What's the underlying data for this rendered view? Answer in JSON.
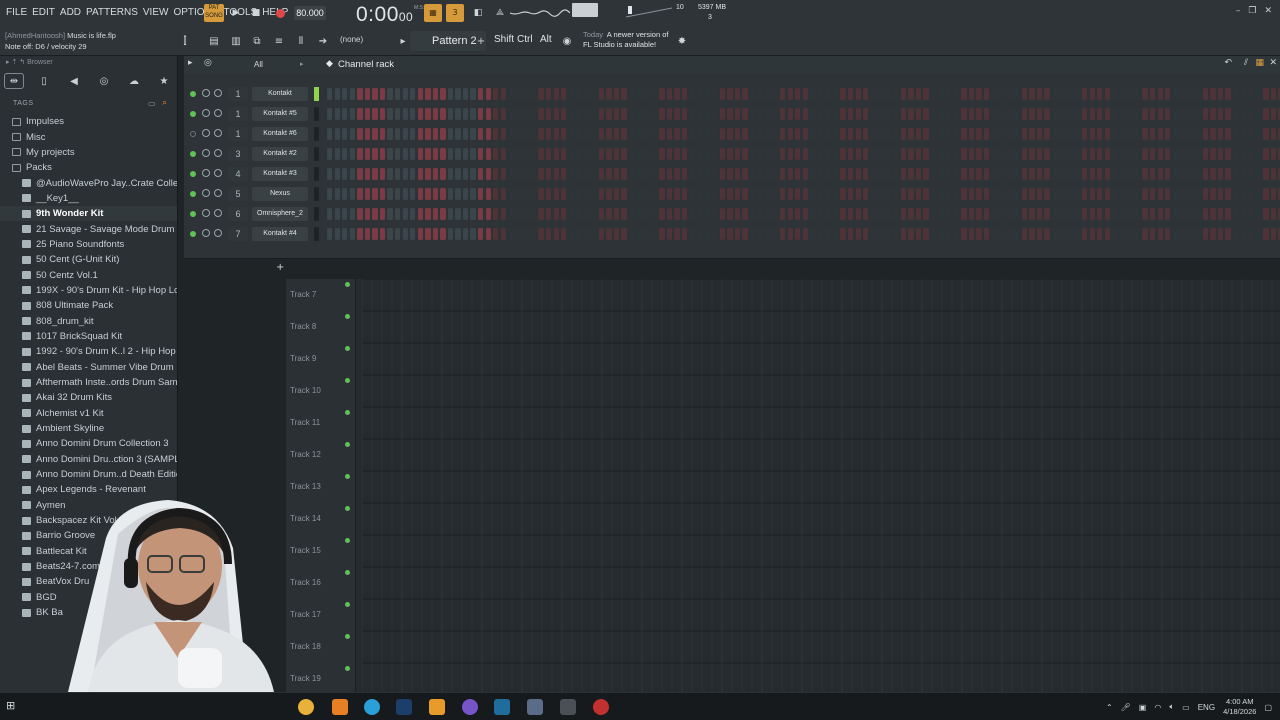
{
  "menu": [
    "FILE",
    "EDIT",
    "ADD",
    "PATTERNS",
    "VIEW",
    "OPTIONS",
    "TOOLS",
    "HELP"
  ],
  "hint": {
    "project_user": "[AhmedHantoosh]",
    "project_file": "Music is life.flp",
    "status": "Note off: D6 / velocity 29"
  },
  "transport": {
    "pat_song": "PAT\nSONG",
    "play": "▶",
    "stop": "■",
    "tempo": "80.000",
    "time_main": "0:00",
    "time_ms": "00",
    "time_unit": "M:S:CS"
  },
  "stats": {
    "cpu": "10",
    "memory": "5397 MB",
    "polyphony": "3"
  },
  "toolbar2": {
    "none_label": "(none)",
    "pattern": "Pattern 2",
    "shift": "Shift",
    "ctrl": "Ctrl",
    "alt": "Alt",
    "news_label": "Today",
    "news_line1": "A newer version of",
    "news_line2": "FL Studio is available!"
  },
  "browser": {
    "title": "Browser",
    "tags_label": "TAGS",
    "items": [
      {
        "label": "Impulses",
        "level": 0
      },
      {
        "label": "Misc",
        "level": 0
      },
      {
        "label": "My projects",
        "level": 0
      },
      {
        "label": "Packs",
        "level": 0
      },
      {
        "label": "@AudioWavePro Jay..Crate Collection",
        "level": 1
      },
      {
        "label": "__Key1__",
        "level": 1
      },
      {
        "label": "9th Wonder Kit",
        "level": 1,
        "selected": true
      },
      {
        "label": "21 Savage - Savage Mode Drum Kit",
        "level": 1
      },
      {
        "label": "25 Piano Soundfonts",
        "level": 1
      },
      {
        "label": "50 Cent (G-Unit Kit)",
        "level": 1
      },
      {
        "label": "50 Centz Vol.1",
        "level": 1
      },
      {
        "label": "199X - 90's Drum Kit - Hip Hop Lofi",
        "level": 1
      },
      {
        "label": "808 Ultimate Pack",
        "level": 1
      },
      {
        "label": "808_drum_kit",
        "level": 1
      },
      {
        "label": "1017 BrickSquad Kit",
        "level": 1
      },
      {
        "label": "1992 - 90's Drum K..l 2 - Hip Hop Lofi",
        "level": 1
      },
      {
        "label": "Abel Beats - Summer Vibe Drum Kit",
        "level": 1
      },
      {
        "label": "Afthermath Inste..ords Drum Samples",
        "level": 1
      },
      {
        "label": "Akai 32 Drum Kits",
        "level": 1
      },
      {
        "label": "Alchemist v1 Kit",
        "level": 1
      },
      {
        "label": "Ambient Skyline",
        "level": 1
      },
      {
        "label": "Anno Domini Drum Collection 3",
        "level": 1
      },
      {
        "label": "Anno Domini Dru..ction 3 (SAMPLER)",
        "level": 1
      },
      {
        "label": "Anno Domini Drum..d Death Edition 3",
        "level": 1
      },
      {
        "label": "Apex Legends - Revenant",
        "level": 1
      },
      {
        "label": "Aymen",
        "level": 1
      },
      {
        "label": "Backspacez Kit Vol",
        "level": 1
      },
      {
        "label": "Barrio Groove",
        "level": 1
      },
      {
        "label": "Battlecat Kit",
        "level": 1
      },
      {
        "label": "Beats24-7.com",
        "level": 1
      },
      {
        "label": "BeatVox Dru",
        "level": 1
      },
      {
        "label": "BGD",
        "level": 1
      },
      {
        "label": "BK Ba",
        "level": 1
      }
    ]
  },
  "rack": {
    "filter": "All",
    "title": "Channel rack",
    "channels": [
      {
        "num": "1",
        "name": "Kontakt",
        "on": true,
        "selected": true
      },
      {
        "num": "1",
        "name": "Kontakt #5",
        "on": true
      },
      {
        "num": "1",
        "name": "Kontakt #6",
        "on": false
      },
      {
        "num": "3",
        "name": "Kontakt #2",
        "on": true
      },
      {
        "num": "4",
        "name": "Kontakt #3",
        "on": true
      },
      {
        "num": "5",
        "name": "Nexus",
        "on": true
      },
      {
        "num": "6",
        "name": "Omnisphere_2",
        "on": true
      },
      {
        "num": "7",
        "name": "Kontakt #4",
        "on": true
      }
    ]
  },
  "playlist": {
    "add_label": "+",
    "tracks": [
      "Track 7",
      "Track 8",
      "Track 9",
      "Track 10",
      "Track 11",
      "Track 12",
      "Track 13",
      "Track 14",
      "Track 15",
      "Track 16",
      "Track 17",
      "Track 18",
      "Track 19"
    ]
  },
  "taskbar": {
    "language": "ENG",
    "time": "4:00 AM",
    "date": "4/18/2026"
  }
}
